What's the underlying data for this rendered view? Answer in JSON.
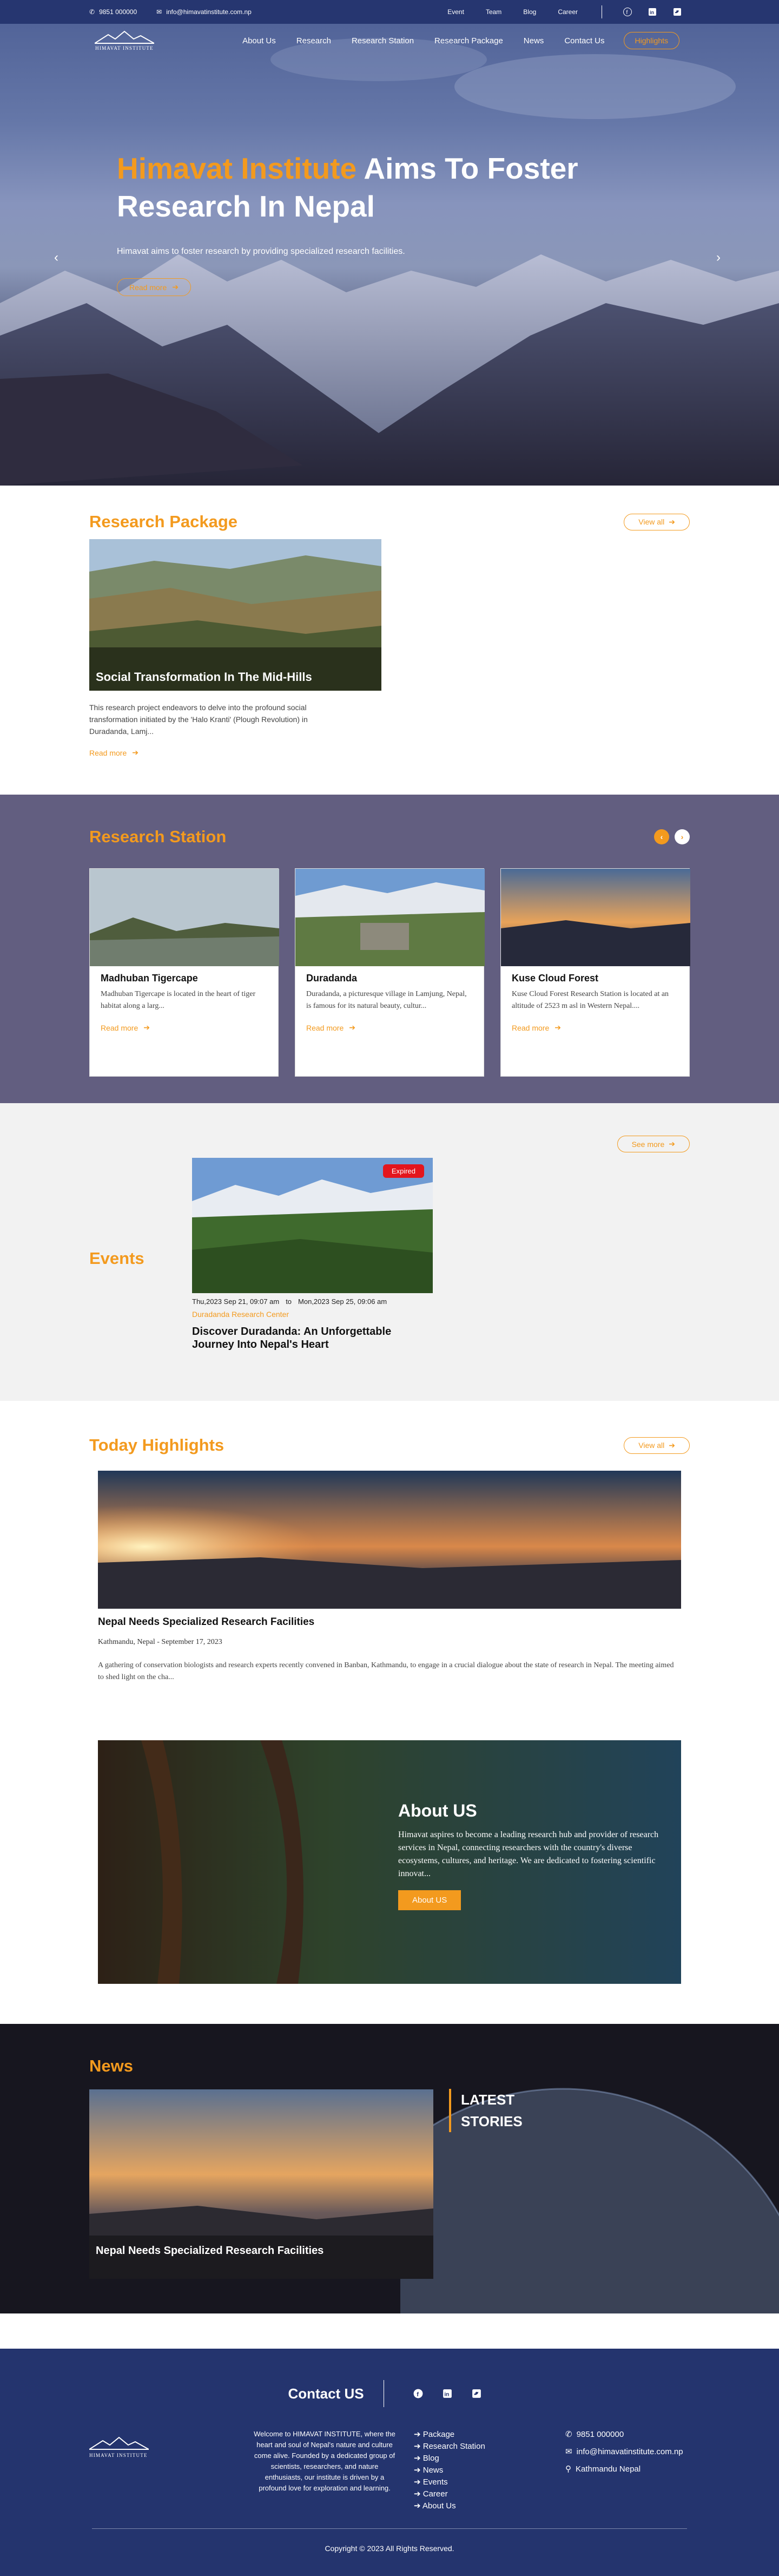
{
  "topbar": {
    "phone": "9851 000000",
    "email": "info@himavatinstitute.com.np",
    "links": [
      "Event",
      "Team",
      "Blog",
      "Career"
    ]
  },
  "nav": {
    "logo_text": "HIMAVAT INSTITUTE",
    "items": [
      "About Us",
      "Research",
      "Research Station",
      "Research Package",
      "News",
      "Contact Us"
    ],
    "cta": "Highlights"
  },
  "hero": {
    "title_accent": "Himavat Institute",
    "title_rest": " Aims To Foster Research In Nepal",
    "subtitle": "Himavat aims to foster research by providing specialized research facilities.",
    "button": "Read more"
  },
  "research_package": {
    "title": "Research Package",
    "view_all": "View all",
    "card": {
      "caption": "Social Transformation In The Mid-Hills",
      "description": "This research project endeavors to delve into the profound social transformation initiated by the 'Halo Kranti' (Plough Revolution) in Duradanda, Lamj...",
      "read_more": "Read more"
    }
  },
  "research_station": {
    "title": "Research Station",
    "cards": [
      {
        "name": "Madhuban Tigercape",
        "desc": "Madhuban Tigercape is located in the heart of tiger habitat along a larg...",
        "read_more": "Read more"
      },
      {
        "name": "Duradanda",
        "desc": "Duradanda, a picturesque village in Lamjung, Nepal, is famous for its natural beauty, cultur...",
        "read_more": "Read more"
      },
      {
        "name": "Kuse Cloud Forest",
        "desc": "Kuse Cloud Forest Research Station is located at an altitude of 2523 m asl in Western Nepal....",
        "read_more": "Read more"
      }
    ]
  },
  "events": {
    "title": "Events",
    "see_more": "See more",
    "card": {
      "badge": "Expired",
      "start": "Thu,2023 Sep 21, 09:07 am",
      "to": "to",
      "end": "Mon,2023 Sep 25, 09:06 am",
      "location": "Duradanda Research Center",
      "title": "Discover Duradanda: An Unforgettable Journey Into Nepal's Heart"
    }
  },
  "highlights": {
    "title": "Today Highlights",
    "view_all": "View all",
    "article": {
      "title": "Nepal Needs Specialized Research Facilities",
      "meta": "Kathmandu, Nepal - September 17, 2023",
      "desc": "A gathering of conservation biologists and research experts recently convened in Banban, Kathmandu, to engage in a crucial dialogue about the state of research in Nepal. The meeting aimed to shed light on the cha..."
    }
  },
  "about": {
    "title": "About US",
    "desc": "Himavat aspires to become a leading research hub and provider of research services in Nepal, connecting researchers with the country's diverse ecosystems, cultures, and heritage. We are dedicated to fostering scientific innovat...",
    "button": "About US"
  },
  "news": {
    "title": "News",
    "caption": "Nepal Needs Specialized Research Facilities",
    "latest_1": "LATEST",
    "latest_2": "STORIES"
  },
  "footer": {
    "contact_title": "Contact US",
    "logo_text": "HIMAVAT INSTITUTE",
    "about": "Welcome to HIMAVAT INSTITUTE, where the heart and soul of Nepal's nature and culture come alive. Founded by a dedicated group of scientists, researchers, and nature enthusiasts, our institute is driven by a profound love for exploration and learning.",
    "links": [
      "Package",
      "Research Station",
      "Blog",
      "News",
      "Events",
      "Career",
      "About Us"
    ],
    "phone": "9851 000000",
    "email": "info@himavatinstitute.com.np",
    "address": "Kathmandu Nepal",
    "copyright": "Copyright © 2023 All Rights Reserved."
  },
  "colors": {
    "accent": "#f39a1e",
    "navy": "#24346e",
    "station_bg": "#625e80",
    "expired": "#e3161d"
  }
}
